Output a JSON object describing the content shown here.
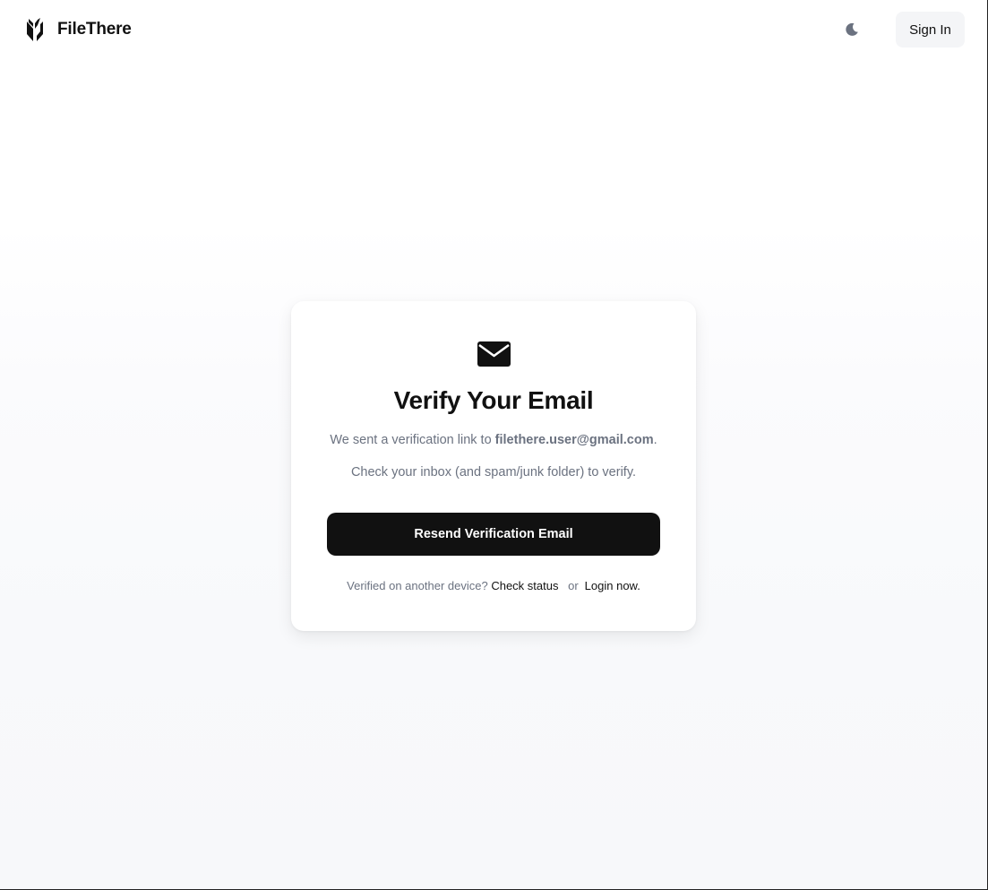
{
  "header": {
    "brand_name": "FileThere",
    "sign_in_label": "Sign In"
  },
  "card": {
    "title": "Verify Your Email",
    "sent_prefix": "We sent a verification link to ",
    "email": "filethere.user@gmail.com",
    "sent_suffix": ".",
    "instructions": "Check your inbox (and spam/junk folder) to verify.",
    "resend_label": "Resend Verification Email",
    "footer_prefix": "Verified on another device?",
    "check_status_label": "Check status",
    "or_label": "or",
    "login_label": "Login now."
  },
  "icons": {
    "logo": "filethere-logo-icon",
    "theme": "moon-icon",
    "mail": "envelope-icon"
  },
  "colors": {
    "primary": "#111111",
    "muted_text": "#6b7280",
    "signin_bg": "#f4f5f7",
    "moon": "#6b7280"
  }
}
